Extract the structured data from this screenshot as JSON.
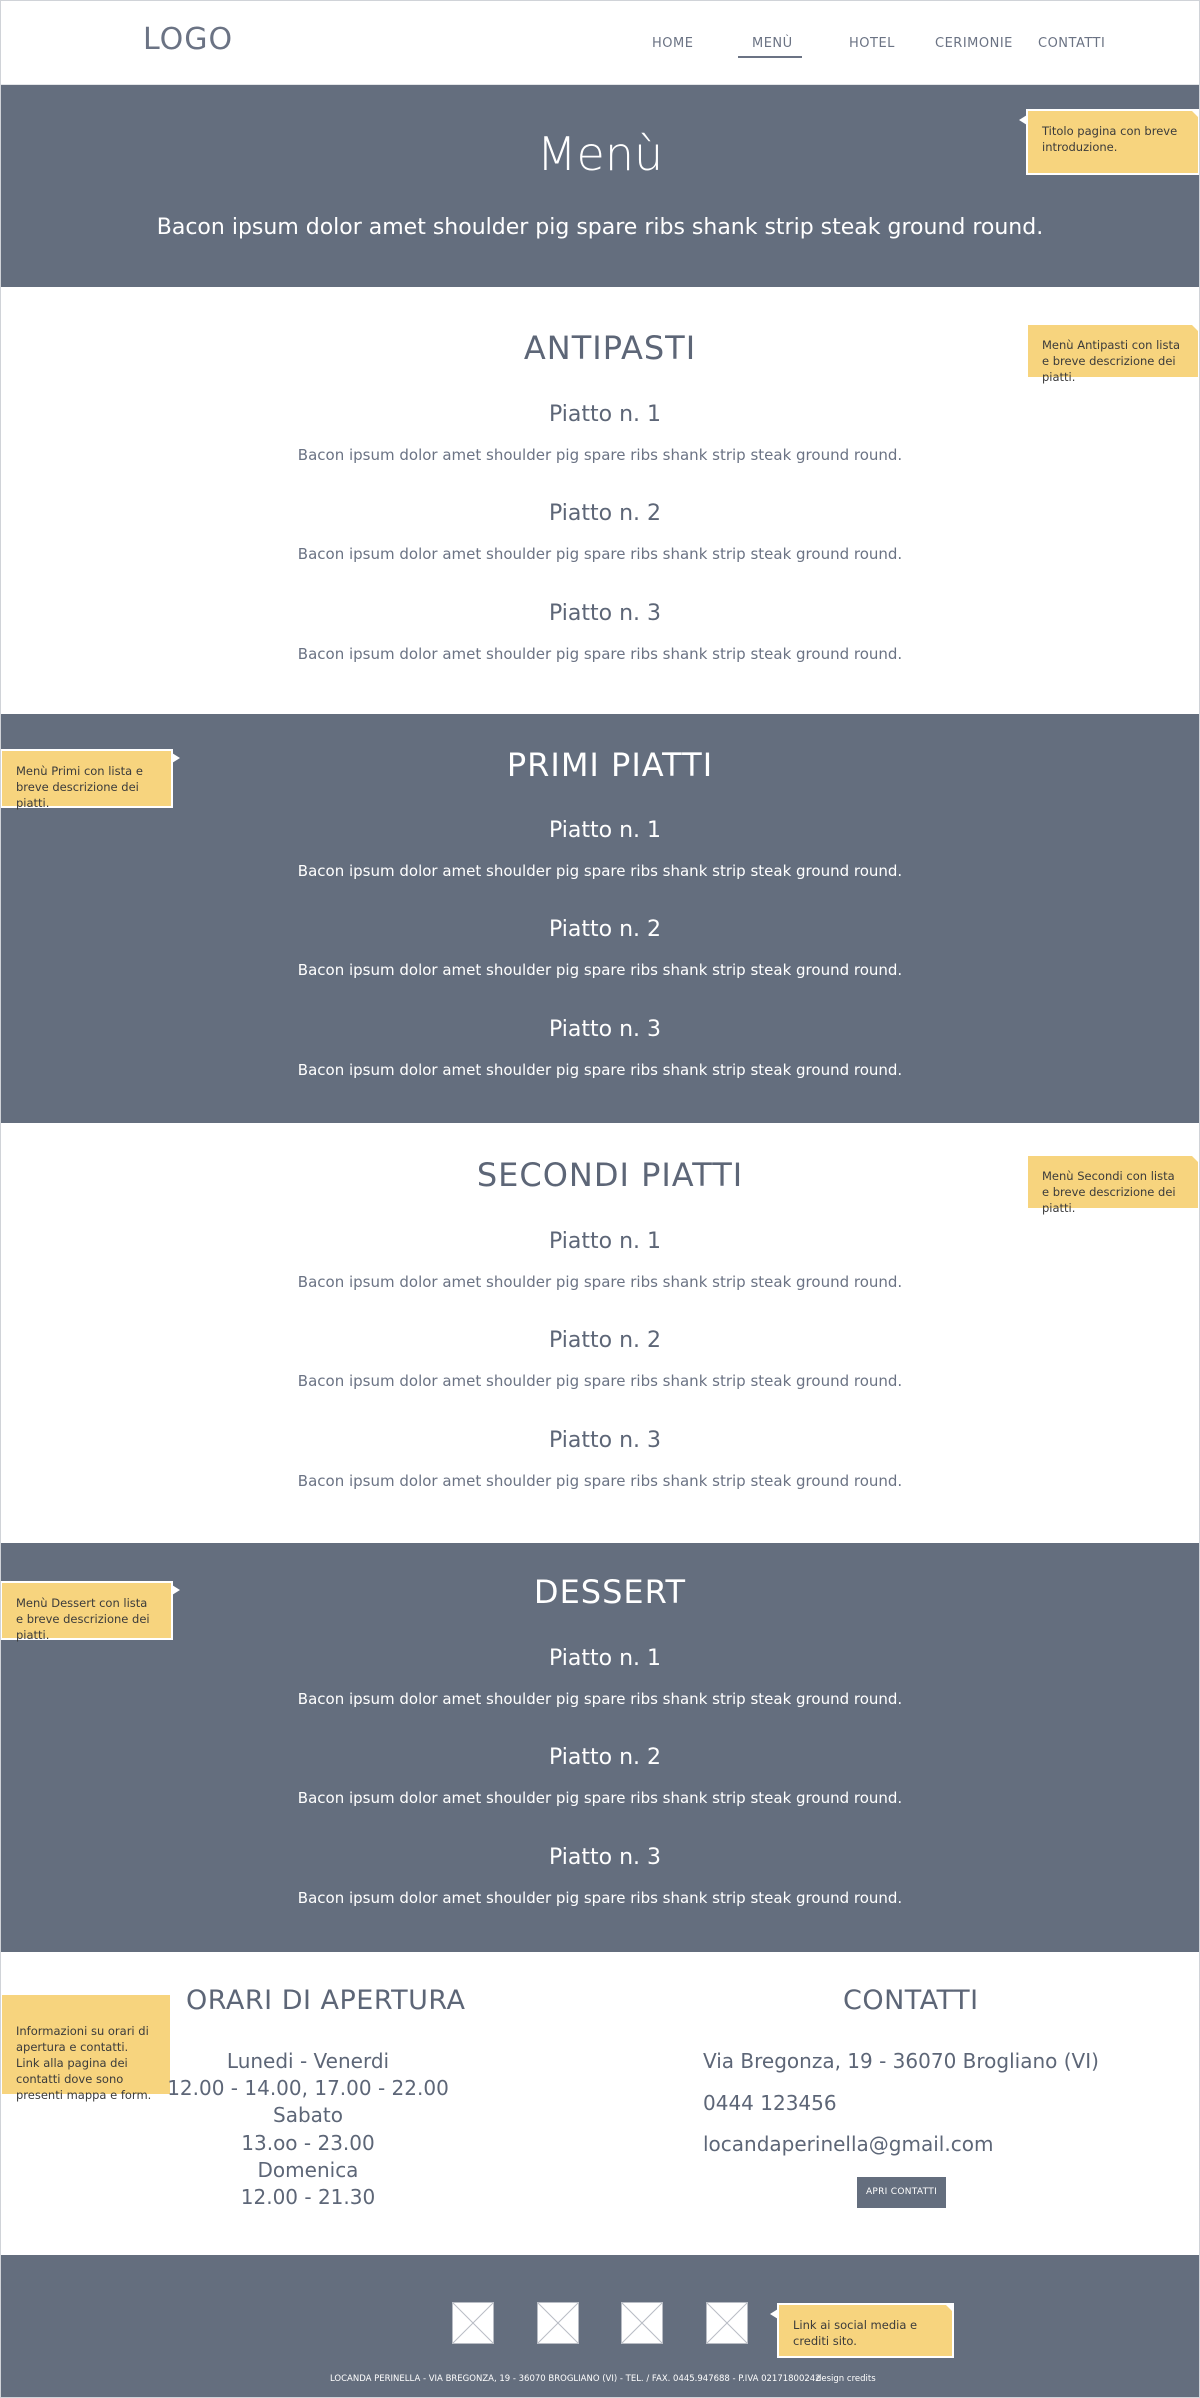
{
  "header": {
    "logo": "LOGO",
    "nav": [
      "HOME",
      "MENÙ",
      "HOTEL",
      "CERIMONIE",
      "CONTATTI"
    ]
  },
  "hero": {
    "title": "Menù",
    "subtitle": "Bacon ipsum dolor amet shoulder pig spare ribs shank strip steak ground round.",
    "note": "Titolo pagina con breve introduzione."
  },
  "sections": [
    {
      "title": "ANTIPASTI",
      "note": "Menù Antipasti con lista e breve descrizione dei piatti.",
      "dishes": [
        {
          "name": "Piatto n. 1",
          "desc": "Bacon ipsum dolor amet shoulder pig spare ribs shank strip steak ground round."
        },
        {
          "name": "Piatto n. 2",
          "desc": "Bacon ipsum dolor amet shoulder pig spare ribs shank strip steak ground round."
        },
        {
          "name": "Piatto n. 3",
          "desc": "Bacon ipsum dolor amet shoulder pig spare ribs shank strip steak ground round."
        }
      ]
    },
    {
      "title": "PRIMI PIATTI",
      "note": "Menù Primi con lista e breve descrizione dei piatti.",
      "dishes": [
        {
          "name": "Piatto n. 1",
          "desc": "Bacon ipsum dolor amet shoulder pig spare ribs shank strip steak ground round."
        },
        {
          "name": "Piatto n. 2",
          "desc": "Bacon ipsum dolor amet shoulder pig spare ribs shank strip steak ground round."
        },
        {
          "name": "Piatto n. 3",
          "desc": "Bacon ipsum dolor amet shoulder pig spare ribs shank strip steak ground round."
        }
      ]
    },
    {
      "title": "SECONDI PIATTI",
      "note": "Menù Secondi con lista e breve descrizione dei piatti.",
      "dishes": [
        {
          "name": "Piatto n. 1",
          "desc": "Bacon ipsum dolor amet shoulder pig spare ribs shank strip steak ground round."
        },
        {
          "name": "Piatto n. 2",
          "desc": "Bacon ipsum dolor amet shoulder pig spare ribs shank strip steak ground round."
        },
        {
          "name": "Piatto n. 3",
          "desc": "Bacon ipsum dolor amet shoulder pig spare ribs shank strip steak ground round."
        }
      ]
    },
    {
      "title": "DESSERT",
      "note": "Menù Dessert con lista e breve descrizione dei piatti.",
      "dishes": [
        {
          "name": "Piatto n. 1",
          "desc": "Bacon ipsum dolor amet shoulder pig spare ribs shank strip steak ground round."
        },
        {
          "name": "Piatto n. 2",
          "desc": "Bacon ipsum dolor amet shoulder pig spare ribs shank strip steak ground round."
        },
        {
          "name": "Piatto n. 3",
          "desc": "Bacon ipsum dolor amet shoulder pig spare ribs shank strip steak ground round."
        }
      ]
    }
  ],
  "info": {
    "note": "Informazioni su orari di apertura e contatti.\nLink alla pagina dei contatti dove sono presenti mappa e form.",
    "hours_title": "ORARI DI APERTURA",
    "hours": [
      "Lunedi - Venerdi",
      "12.00 - 14.00, 17.00 - 22.00",
      "Sabato",
      "13.oo - 23.00",
      "Domenica",
      "12.00 - 21.30"
    ],
    "contacts_title": "CONTATTI",
    "address": "Via Bregonza, 19 - 36070 Brogliano (VI)",
    "phone": "0444 123456",
    "email": "locandaperinella@gmail.com",
    "button": "APRI CONTATTI"
  },
  "footer": {
    "note": "Link ai social media e crediti sito.",
    "legal": "LOCANDA PERINELLA - VIA BREGONZA, 19 - 36070 BROGLIANO (VI) - TEL. / FAX. 0445.947688 - P.IVA 02171800242",
    "credits": "design credits",
    "socials": [
      "social-1",
      "social-2",
      "social-3",
      "social-4"
    ]
  },
  "colors": {
    "band_dark": "#646e7e",
    "note_yellow": "#f7d47e",
    "text": "#5d6677"
  }
}
